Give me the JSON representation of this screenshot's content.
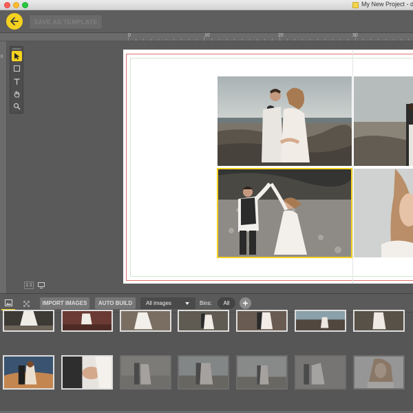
{
  "window": {
    "title": "My New Project - de",
    "colors": {
      "accent": "#f4d21f",
      "chrome": "#5e5e5e",
      "bleed": "#e0706a"
    }
  },
  "toolbar": {
    "back_icon": "arrow-left-icon",
    "save_template_label": "SAVE AS TEMPLATE"
  },
  "ruler": {
    "top_ticks": [
      "0",
      "10",
      "20",
      "30"
    ],
    "left_ticks": [
      "0",
      "",
      "",
      "",
      "",
      "",
      "",
      ""
    ]
  },
  "tools": [
    {
      "name": "select-tool",
      "icon": "pointer-icon",
      "active": true
    },
    {
      "name": "frame-tool",
      "icon": "frame-icon",
      "active": false
    },
    {
      "name": "text-tool",
      "icon": "text-icon",
      "active": false
    },
    {
      "name": "hand-tool",
      "icon": "hand-icon",
      "active": false
    },
    {
      "name": "zoom-tool",
      "icon": "magnifier-icon",
      "active": false
    }
  ],
  "zoom": {
    "actual_size_label": "1:1",
    "fit_icon": "monitor-icon"
  },
  "bin_bar": {
    "import_label": "IMPORT IMAGES",
    "auto_build_label": "AUTO BUILD",
    "filter_value": "All images",
    "bins_label": "Bins:",
    "bin_selected": "All",
    "add_bin_icon": "plus-icon"
  }
}
